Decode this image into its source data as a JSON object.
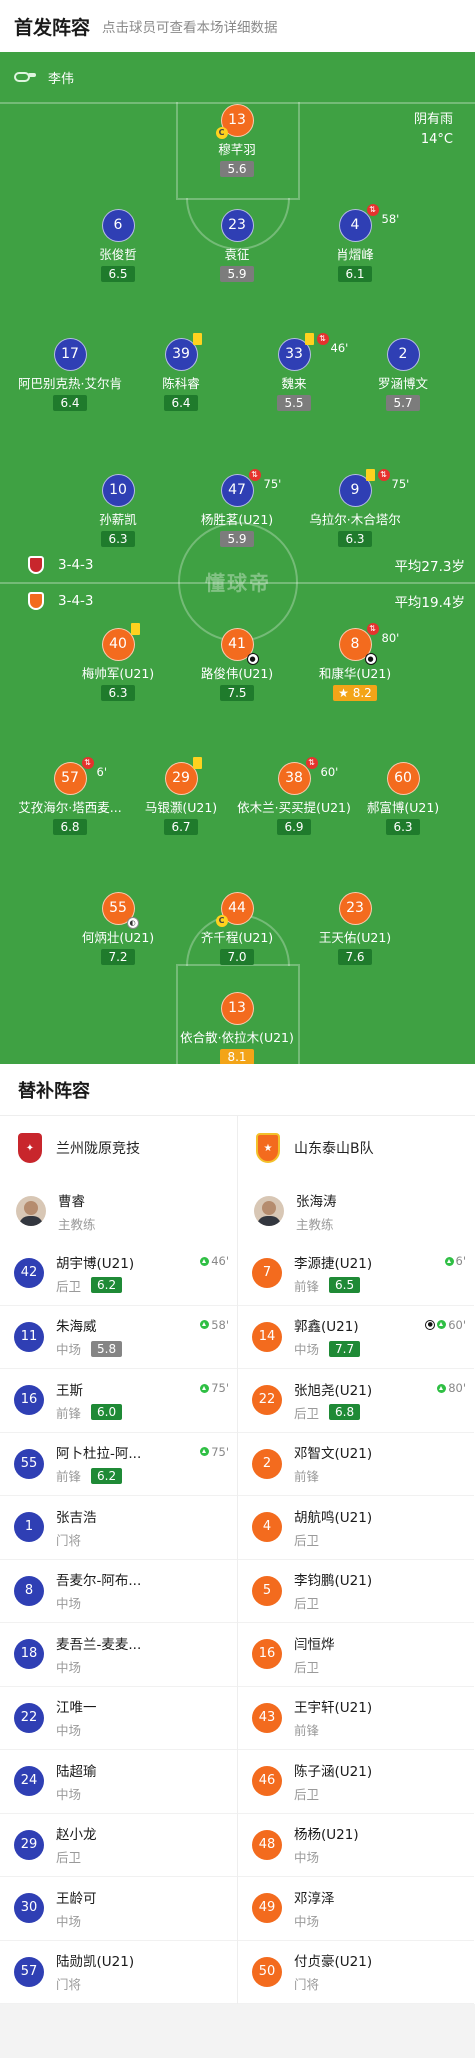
{
  "header": {
    "title": "首发阵容",
    "subtitle": "点击球员可查看本场详细数据"
  },
  "pitch": {
    "referee": "李伟",
    "weather": "阴有雨",
    "temperature": "14°C",
    "watermark": "懂球帝",
    "home": {
      "formation": "3-4-3",
      "avg_age": "平均27.3岁",
      "crest_color": "#c8262c"
    },
    "away": {
      "formation": "3-4-3",
      "avg_age": "平均19.4岁",
      "crest_color": "#f36b1e"
    }
  },
  "home_players": [
    {
      "num": "13",
      "name": "穆芊羽",
      "rating": "5.6",
      "rating_style": "grey",
      "captain": true
    },
    {
      "num": "6",
      "name": "张俊哲",
      "rating": "6.5"
    },
    {
      "num": "23",
      "name": "袁征",
      "rating": "5.9",
      "rating_style": "grey"
    },
    {
      "num": "4",
      "name": "肖熠峰",
      "rating": "6.1",
      "sub_out": "58'"
    },
    {
      "num": "17",
      "name": "阿巴别克热·艾尔肯",
      "rating": "6.4"
    },
    {
      "num": "39",
      "name": "陈科睿",
      "rating": "6.4",
      "yellow": true
    },
    {
      "num": "33",
      "name": "魏来",
      "rating": "5.5",
      "rating_style": "grey",
      "yellow": true,
      "sub_out": "46'"
    },
    {
      "num": "2",
      "name": "罗涵博文",
      "rating": "5.7",
      "rating_style": "grey"
    },
    {
      "num": "10",
      "name": "孙薪凯",
      "rating": "6.3"
    },
    {
      "num": "47",
      "name": "杨胜茗(U21)",
      "rating": "5.9",
      "rating_style": "grey",
      "sub_out": "75'"
    },
    {
      "num": "9",
      "name": "乌拉尔·木合塔尔",
      "rating": "6.3",
      "yellow": true,
      "sub_out": "75'"
    }
  ],
  "away_players": [
    {
      "num": "40",
      "name": "梅帅军(U21)",
      "rating": "6.3",
      "yellow": true
    },
    {
      "num": "41",
      "name": "路俊伟(U21)",
      "rating": "7.5",
      "goal": true
    },
    {
      "num": "8",
      "name": "和康华(U21)",
      "rating": "8.2",
      "rating_style": "gold",
      "sub_out": "80'",
      "goal": true,
      "mvp": true
    },
    {
      "num": "57",
      "name": "艾孜海尔·塔西麦...",
      "rating": "6.8",
      "sub_out": "6'"
    },
    {
      "num": "29",
      "name": "马银灏(U21)",
      "rating": "6.7",
      "yellow": true
    },
    {
      "num": "38",
      "name": "依木兰·买买提(U21)",
      "rating": "6.9",
      "sub_out": "60'"
    },
    {
      "num": "60",
      "name": "郝富博(U21)",
      "rating": "6.3"
    },
    {
      "num": "55",
      "name": "何炳壮(U21)",
      "rating": "7.2",
      "assist": true
    },
    {
      "num": "44",
      "name": "齐千程(U21)",
      "rating": "7.0",
      "captain": true
    },
    {
      "num": "23",
      "name": "王天佑(U21)",
      "rating": "7.6"
    },
    {
      "num": "13",
      "name": "依合散·依拉木(U21)",
      "rating": "8.1",
      "rating_style": "gold"
    }
  ],
  "subs": {
    "title": "替补阵容",
    "home": {
      "team": "兰州陇原竞技",
      "coach": {
        "name": "曹睿",
        "role": "主教练"
      },
      "players": [
        {
          "num": "42",
          "name": "胡宇博(U21)",
          "pos": "后卫",
          "rating": "6.2",
          "time": "46'"
        },
        {
          "num": "11",
          "name": "朱海威",
          "pos": "中场",
          "rating": "5.8",
          "rating_style": "grey",
          "time": "58'"
        },
        {
          "num": "16",
          "name": "王斯",
          "pos": "前锋",
          "rating": "6.0",
          "time": "75'"
        },
        {
          "num": "55",
          "name": "阿卜杜拉-阿...",
          "pos": "前锋",
          "rating": "6.2",
          "time": "75'"
        },
        {
          "num": "1",
          "name": "张吉浩",
          "pos": "门将"
        },
        {
          "num": "8",
          "name": "吾麦尔-阿布...",
          "pos": "中场"
        },
        {
          "num": "18",
          "name": "麦吾兰-麦麦...",
          "pos": "中场"
        },
        {
          "num": "22",
          "name": "江唯一",
          "pos": "中场"
        },
        {
          "num": "24",
          "name": "陆超瑜",
          "pos": "中场"
        },
        {
          "num": "29",
          "name": "赵小龙",
          "pos": "后卫"
        },
        {
          "num": "30",
          "name": "王龄可",
          "pos": "中场"
        },
        {
          "num": "57",
          "name": "陆勋凯(U21)",
          "pos": "门将"
        }
      ]
    },
    "away": {
      "team": "山东泰山B队",
      "coach": {
        "name": "张海涛",
        "role": "主教练"
      },
      "players": [
        {
          "num": "7",
          "name": "李源捷(U21)",
          "pos": "前锋",
          "rating": "6.5",
          "time": "6'"
        },
        {
          "num": "14",
          "name": "郭鑫(U21)",
          "pos": "中场",
          "rating": "7.7",
          "time": "60'",
          "goal": true
        },
        {
          "num": "22",
          "name": "张旭尧(U21)",
          "pos": "后卫",
          "rating": "6.8",
          "time": "80'"
        },
        {
          "num": "2",
          "name": "邓智文(U21)",
          "pos": "前锋"
        },
        {
          "num": "4",
          "name": "胡航鸣(U21)",
          "pos": "后卫"
        },
        {
          "num": "5",
          "name": "李钧鹏(U21)",
          "pos": "后卫"
        },
        {
          "num": "16",
          "name": "闫恒烨",
          "pos": "后卫"
        },
        {
          "num": "43",
          "name": "王宇轩(U21)",
          "pos": "前锋"
        },
        {
          "num": "46",
          "name": "陈子涵(U21)",
          "pos": "后卫"
        },
        {
          "num": "48",
          "name": "杨杨(U21)",
          "pos": "中场"
        },
        {
          "num": "49",
          "name": "邓淳泽",
          "pos": "中场"
        },
        {
          "num": "50",
          "name": "付贞豪(U21)",
          "pos": "门将"
        }
      ]
    }
  }
}
